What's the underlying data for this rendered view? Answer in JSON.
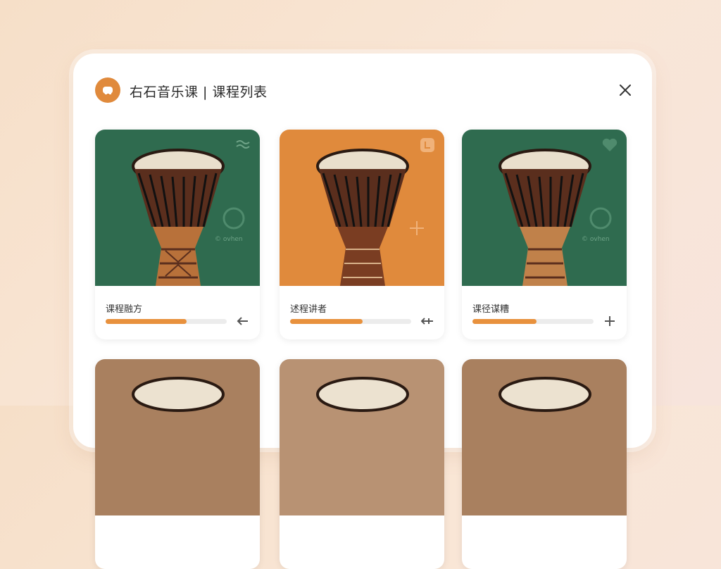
{
  "header": {
    "title": "右石音乐课 | 课程列表"
  },
  "colors": {
    "accent": "#e8913d",
    "green": "#2f6b4f",
    "orange": "#e08a3c",
    "tan": "#a9805f"
  },
  "courses": [
    {
      "title": "课程融方",
      "progress": 0.67,
      "action_icon": "arrow-left-icon",
      "bg": "green",
      "badge_icon": "wave-icon"
    },
    {
      "title": "述程讲者",
      "progress": 0.6,
      "action_icon": "double-arrow-icon",
      "bg": "orange",
      "badge_icon": "level-icon"
    },
    {
      "title": "课径谋糟",
      "progress": 0.53,
      "action_icon": "plus-icon",
      "bg": "green",
      "badge_icon": "heart-icon"
    },
    {
      "title": "",
      "progress": null,
      "action_icon": "",
      "bg": "tan",
      "badge_icon": ""
    },
    {
      "title": "",
      "progress": null,
      "action_icon": "",
      "bg": "tan",
      "badge_icon": ""
    },
    {
      "title": "",
      "progress": null,
      "action_icon": "",
      "bg": "tan",
      "badge_icon": ""
    }
  ],
  "watermark": "© ovhen"
}
